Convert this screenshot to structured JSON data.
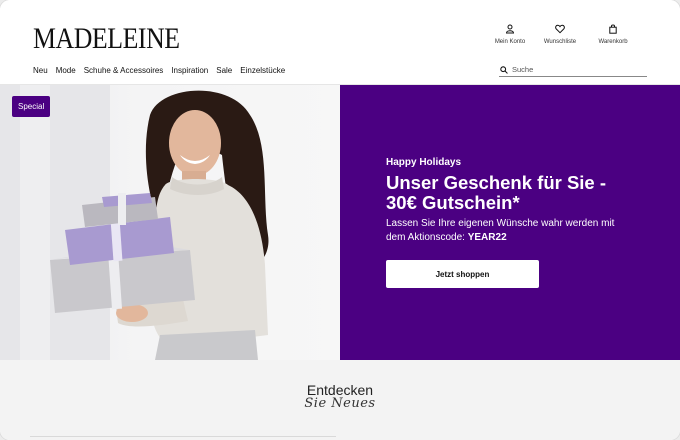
{
  "brand": {
    "logo_text": "MADELEINE"
  },
  "header_actions": [
    {
      "label": "Mein Konto",
      "icon": "user-icon"
    },
    {
      "label": "Wunschliste",
      "icon": "heart-icon"
    },
    {
      "label": "Warenkorb",
      "icon": "bag-icon"
    }
  ],
  "nav": {
    "items": [
      "Neu",
      "Mode",
      "Schuhe & Accessoires",
      "Inspiration",
      "Sale",
      "Einzelstücke"
    ]
  },
  "search": {
    "placeholder": "Suche"
  },
  "hero": {
    "badge": "Special",
    "kicker": "Happy Holidays",
    "headline": "Unser Geschenk für Sie - 30€ Gutschein*",
    "sub_text": "Lassen Sie Ihre eigenen Wünsche wahr werden mit dem Aktionscode: ",
    "promo_code": "YEAR22",
    "cta_label": "Jetzt shoppen"
  },
  "discover": {
    "title": "Entdecken",
    "script": "Sie Neues"
  },
  "colors": {
    "accent": "#4b0082",
    "badge": "#4b0082"
  }
}
